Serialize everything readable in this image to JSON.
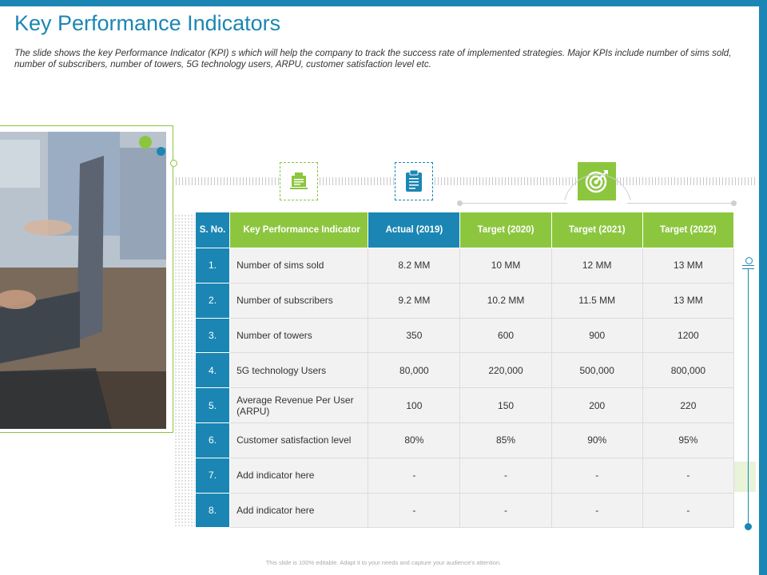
{
  "title": "Key Performance Indicators",
  "subtitle": "The slide shows the key Performance Indicator (KPI) s which will help the company to track the success rate of implemented strategies. Major KPIs include number of sims sold, number of subscribers, number of towers, 5G technology users, ARPU, customer satisfaction level etc.",
  "icons": {
    "first": "document-icon",
    "second": "clipboard-icon",
    "third": "target-icon"
  },
  "table": {
    "headers": {
      "sno": "S. No.",
      "kpi": "Key Performance Indicator",
      "actual": "Actual (2019)",
      "target1": "Target (2020)",
      "target2": "Target (2021)",
      "target3": "Target (2022)"
    },
    "rows": [
      {
        "sno": "1.",
        "name": "Number of sims sold",
        "actual": "8.2 MM",
        "t2020": "10 MM",
        "t2021": "12 MM",
        "t2022": "13 MM"
      },
      {
        "sno": "2.",
        "name": "Number of subscribers",
        "actual": "9.2 MM",
        "t2020": "10.2 MM",
        "t2021": "11.5 MM",
        "t2022": "13 MM"
      },
      {
        "sno": "3.",
        "name": "Number of towers",
        "actual": "350",
        "t2020": "600",
        "t2021": "900",
        "t2022": "1200"
      },
      {
        "sno": "4.",
        "name": "5G technology Users",
        "actual": "80,000",
        "t2020": "220,000",
        "t2021": "500,000",
        "t2022": "800,000"
      },
      {
        "sno": "5.",
        "name": "Average Revenue Per User (ARPU)",
        "actual": "100",
        "t2020": "150",
        "t2021": "200",
        "t2022": "220"
      },
      {
        "sno": "6.",
        "name": "Customer satisfaction level",
        "actual": "80%",
        "t2020": "85%",
        "t2021": "90%",
        "t2022": "95%"
      },
      {
        "sno": "7.",
        "name": "Add indicator here",
        "actual": "-",
        "t2020": "-",
        "t2021": "-",
        "t2022": "-"
      },
      {
        "sno": "8.",
        "name": "Add indicator here",
        "actual": "-",
        "t2020": "-",
        "t2021": "-",
        "t2022": "-"
      }
    ]
  },
  "footer": "This slide is 100% editable. Adapt it to your needs and capture your audience's attention.",
  "colors": {
    "blue": "#1b86b3",
    "green": "#8cc63f"
  }
}
